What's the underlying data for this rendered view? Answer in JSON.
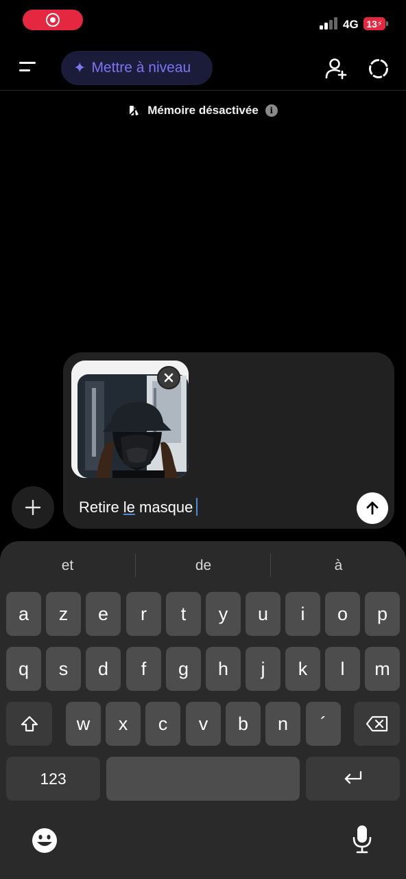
{
  "status_bar": {
    "network": "4G",
    "battery": "13",
    "recording_color": "#e5283f",
    "recording_icon": "screen-recording-icon"
  },
  "header": {
    "menu_icon": "menu-icon",
    "upgrade_label": "Mettre à niveau",
    "upgrade_icon": "sparkle-icon",
    "add_user_icon": "add-person-icon",
    "new_chat_icon": "dashed-circle-icon",
    "accent": "#7b76f2"
  },
  "memory_banner": {
    "label": "Mémoire désactivée",
    "icon": "memory-off-icon",
    "info_icon": "i"
  },
  "composer": {
    "attachment": "masked-person-photo",
    "text_before": "Retire ",
    "text_underlined": "le",
    "text_after": " masque",
    "send_icon": "arrow-up-icon",
    "plus_icon": "plus-icon"
  },
  "keyboard": {
    "suggestions": [
      "et",
      "de",
      "à"
    ],
    "row1": [
      "a",
      "z",
      "e",
      "r",
      "t",
      "y",
      "u",
      "i",
      "o",
      "p"
    ],
    "row2": [
      "q",
      "s",
      "d",
      "f",
      "g",
      "h",
      "j",
      "k",
      "l",
      "m"
    ],
    "row3": [
      "w",
      "x",
      "c",
      "v",
      "b",
      "n",
      "´"
    ],
    "numbers_label": "123",
    "shift_icon": "shift-icon",
    "delete_icon": "backspace-icon",
    "return_icon": "return-icon",
    "emoji_icon": "emoji-icon",
    "mic_icon": "microphone-icon"
  }
}
